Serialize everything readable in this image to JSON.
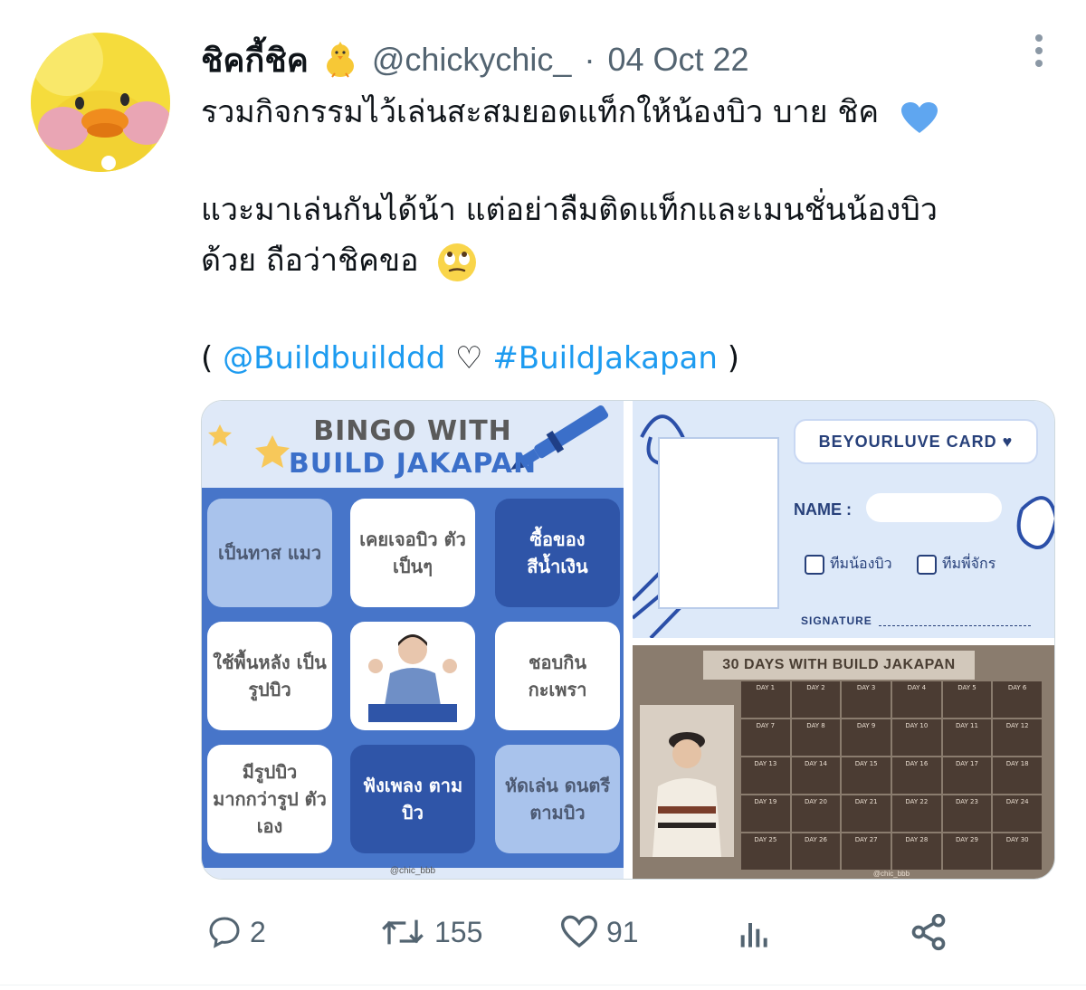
{
  "tweet": {
    "display_name": "ชิคกี้ชิค",
    "handle": "@chickychic_",
    "separator": "·",
    "date": "04 Oct 22",
    "text_line1": "รวมกิจกรรมไว้เล่นสะสมยอดแท็กให้น้องบิว บาย ชิค",
    "text_line2": "แวะมาเล่นกันได้น้า แต่อย่าลืมติดแท็กและเมนชั่นน้องบิว",
    "text_line3": "ด้วย ถือว่าชิคขอ",
    "paren_open": "(",
    "mention": "@Buildbuilddd",
    "heart_glyph": "♡",
    "hashtag": "#BuildJakapan",
    "paren_close": ")"
  },
  "media": {
    "bingo": {
      "title_line1": "BINGO WITH",
      "title_line2": "BUILD JAKAPAN",
      "cells": [
        "เป็นทาส แมว",
        "เคยเจอบิว ตัวเป็นๆ",
        "ซื้อของ สีน้ำเงิน",
        "ใช้พื้นหลัง เป็นรูปบิว",
        "ชอบกิน กะเพรา",
        "มีรูปบิว มากกว่ารูป ตัวเอง",
        "ฟังเพลง ตามบิว",
        "หัดเล่น ดนตรี ตามบิว"
      ],
      "credit": "@chic_bbb"
    },
    "card": {
      "title": "BEYOURLUVE CARD ♥",
      "name_label": "NAME :",
      "option1": "ทีมน้องบิว",
      "option2": "ทีมพี่จักร",
      "signature_label": "SIGNATURE"
    },
    "days30": {
      "title": "30 DAYS WITH BUILD JAKAPAN",
      "days": [
        "DAY 1",
        "DAY 2",
        "DAY 3",
        "DAY 4",
        "DAY 5",
        "DAY 6",
        "DAY 7",
        "DAY 8",
        "DAY 9",
        "DAY 10",
        "DAY 11",
        "DAY 12",
        "DAY 13",
        "DAY 14",
        "DAY 15",
        "DAY 16",
        "DAY 17",
        "DAY 18",
        "DAY 19",
        "DAY 20",
        "DAY 21",
        "DAY 22",
        "DAY 23",
        "DAY 24",
        "DAY 25",
        "DAY 26",
        "DAY 27",
        "DAY 28",
        "DAY 29",
        "DAY 30"
      ],
      "credit": "@chic_bbb"
    }
  },
  "actions": {
    "replies": "2",
    "retweets": "155",
    "likes": "91"
  },
  "colors": {
    "link": "#1d9bf0",
    "muted": "#536471",
    "bingo_blue": "#4775c9"
  }
}
